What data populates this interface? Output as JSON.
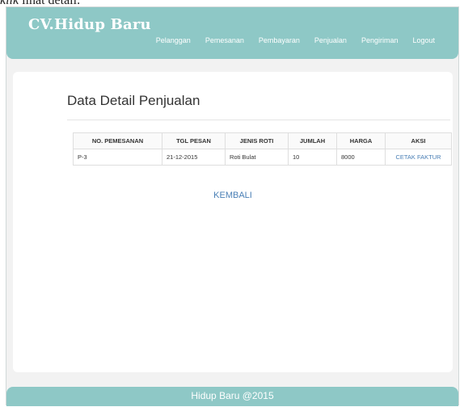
{
  "caption": {
    "word": "klik",
    "rest": "lihat detail."
  },
  "brand": "CV.Hidup Baru",
  "nav": [
    "Pelanggan",
    "Pemesanan",
    "Pembayaran",
    "Penjualan",
    "Pengiriman",
    "Logout"
  ],
  "page_title": "Data Detail Penjualan",
  "table": {
    "headers": [
      "NO. PEMESANAN",
      "TGL PESAN",
      "JENIS ROTI",
      "JUMLAH",
      "HARGA",
      "AKSI"
    ],
    "rows": [
      [
        "P-3",
        "21-12-2015",
        "Roti Bulat",
        "10",
        "8000",
        "CETAK FAKTUR"
      ]
    ]
  },
  "back_label": "KEMBALI",
  "footer": "Hidup Baru @2015",
  "colors": {
    "navbar": "#8ec8c6",
    "link": "#4a7fb5"
  }
}
